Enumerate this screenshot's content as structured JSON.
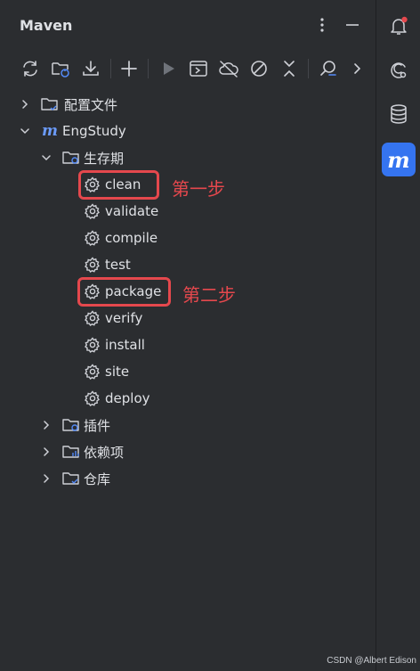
{
  "panel": {
    "title": "Maven",
    "options_icon": "vertical-dots-icon",
    "hide_icon": "minimize-icon"
  },
  "toolbar": [
    {
      "name": "reload-all-maven-projects-button",
      "icon": "reload-icon"
    },
    {
      "name": "generate-sources-button",
      "icon": "folder-refresh-icon"
    },
    {
      "name": "download-sources-button",
      "icon": "download-icon"
    },
    {
      "name": "add-maven-project-button",
      "icon": "plus-icon"
    },
    {
      "name": "run-maven-build-button",
      "icon": "run-icon"
    },
    {
      "name": "execute-maven-goal-button",
      "icon": "terminal-icon"
    },
    {
      "name": "toggle-offline-mode-button",
      "icon": "cloud-off-icon"
    },
    {
      "name": "skip-tests-button",
      "icon": "skip-icon"
    },
    {
      "name": "collapse-all-button",
      "icon": "collapse-icon"
    },
    {
      "name": "analyze-dependencies-button",
      "icon": "analyze-icon"
    },
    {
      "name": "more-actions-button",
      "icon": "chevron-right-icon"
    }
  ],
  "tree": {
    "profiles": "配置文件",
    "project": "EngStudy",
    "lifecycle": "生存期",
    "lifecycle_phases": [
      "clean",
      "validate",
      "compile",
      "test",
      "package",
      "verify",
      "install",
      "site",
      "deploy"
    ],
    "plugins": "插件",
    "dependencies": "依赖项",
    "repositories": "仓库"
  },
  "annotations": {
    "step1": "第一步",
    "step2": "第二步"
  },
  "sidebar": {
    "notifications_icon": "bell-icon",
    "ai_icon": "ai-assistant-icon",
    "database_icon": "database-icon",
    "maven_logo": "m"
  },
  "watermark": "CSDN @Albert Edison",
  "colors": {
    "background": "#2b2d30",
    "text": "#dfe1e5",
    "highlight_red": "#e5484d",
    "accent_blue": "#3574f0"
  }
}
